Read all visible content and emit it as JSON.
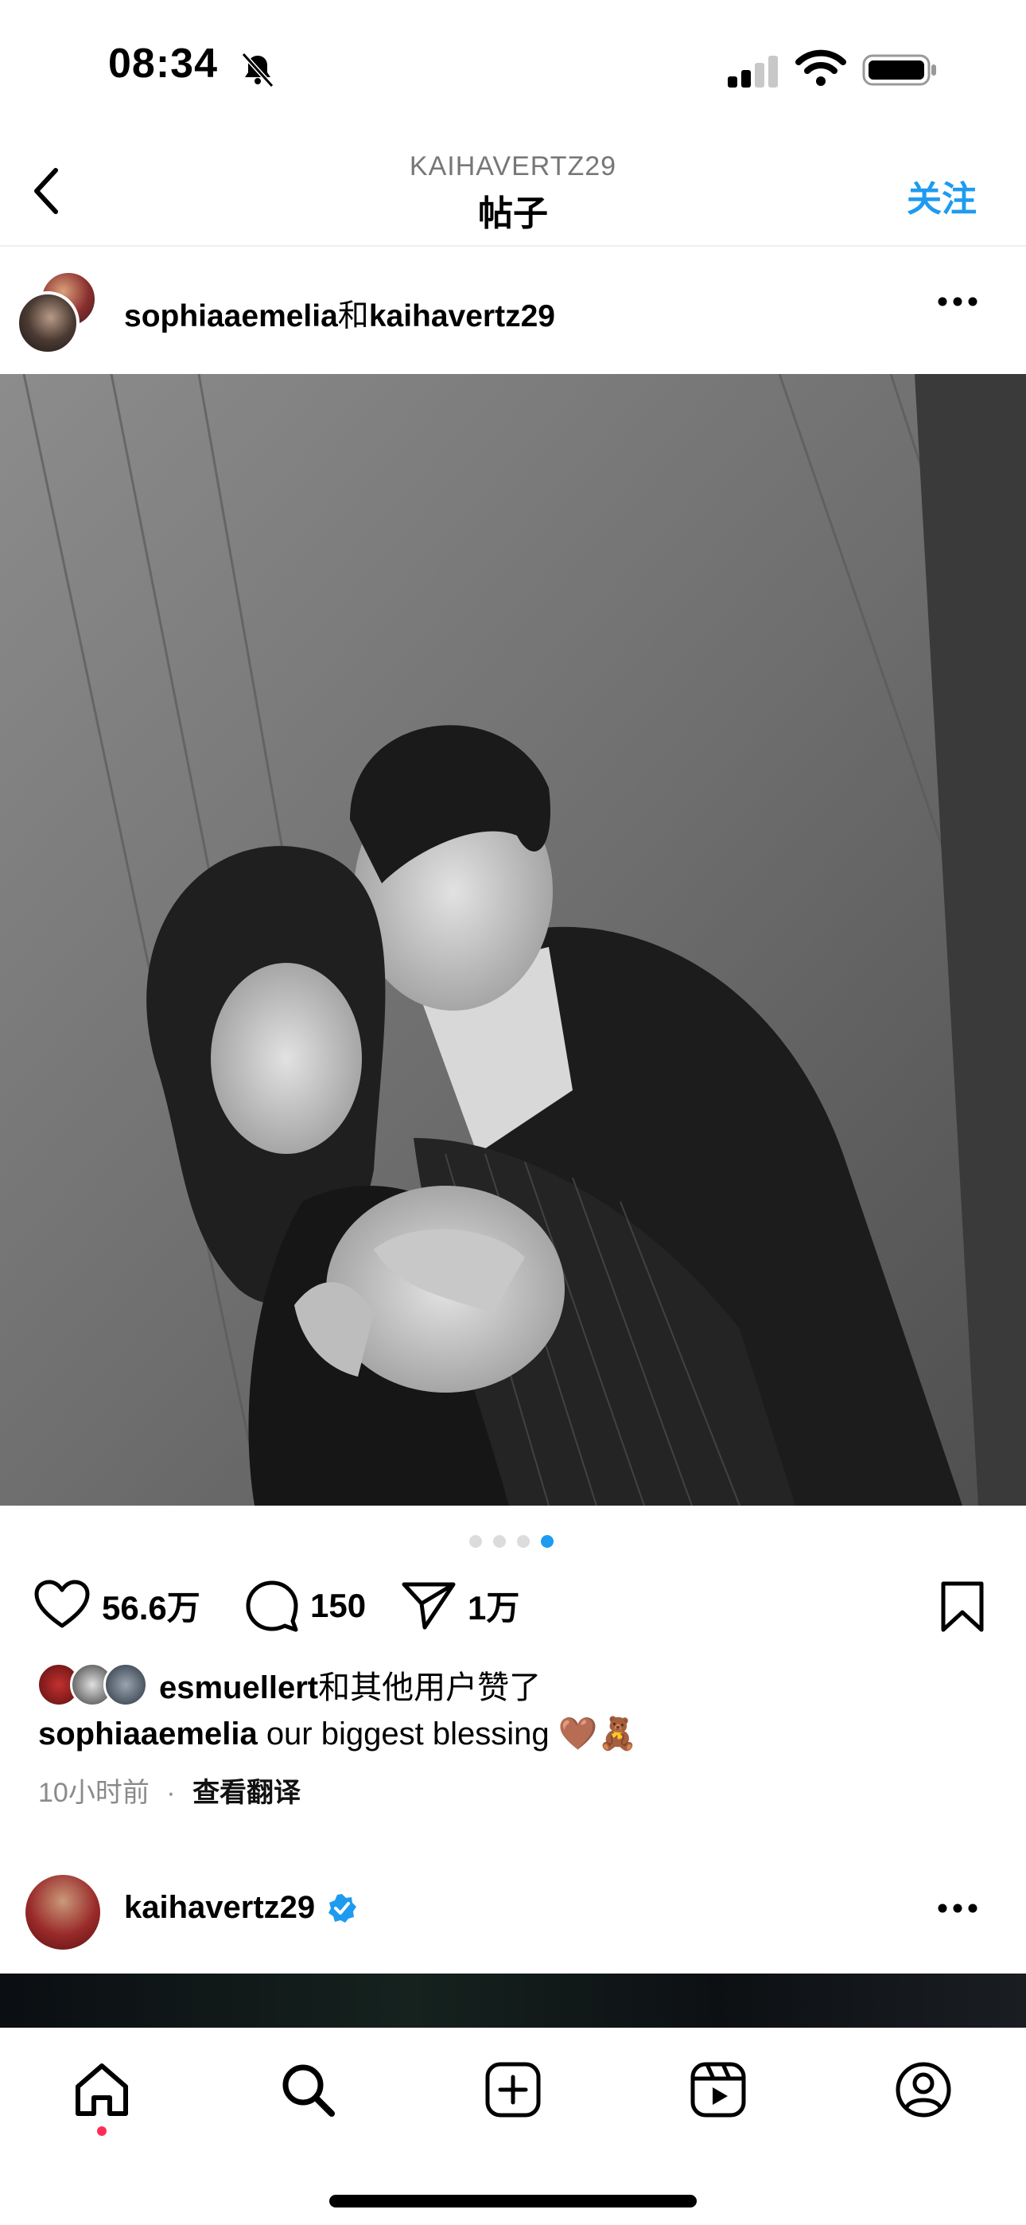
{
  "status_bar": {
    "time": "08:34"
  },
  "header": {
    "username": "KAIHAVERTZ29",
    "title": "帖子",
    "follow": "关注"
  },
  "post": {
    "author_primary": "sophiaaemelia",
    "joiner": "和",
    "author_secondary": "kaihavertz29",
    "carousel": {
      "count": 4,
      "active_index": 4
    },
    "actions": {
      "likes": "56.6万",
      "comments": "150",
      "shares": "1万"
    },
    "liked_by": {
      "user": "esmuellert",
      "suffix": "和其他用户赞了"
    },
    "caption": {
      "user": "sophiaaemelia",
      "text": "our biggest blessing 🤎🧸"
    },
    "time": "10小时前",
    "separator": "·",
    "translate": "查看翻译"
  },
  "next_post": {
    "username": "kaihavertz29",
    "verified": true
  },
  "colors": {
    "accent": "#1d9bf0",
    "notification": "#ff2d55"
  },
  "tabs": [
    "home-icon",
    "search-icon",
    "create-icon",
    "reels-icon",
    "profile-icon"
  ]
}
